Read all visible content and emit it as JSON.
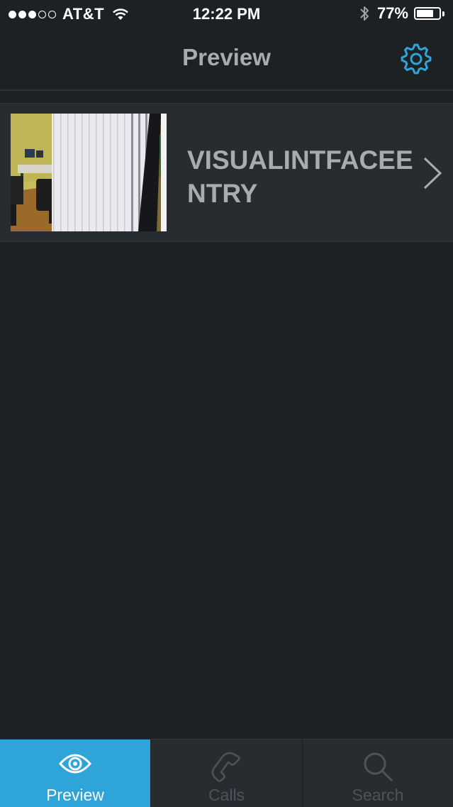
{
  "status_bar": {
    "signal_filled": 3,
    "signal_total": 5,
    "carrier": "AT&T",
    "time": "12:22 PM",
    "battery_percent_text": "77%",
    "battery_level": 0.77
  },
  "nav": {
    "title": "Preview",
    "settings_icon": "gear-icon",
    "accent_color": "#2ea4d9"
  },
  "cameras": [
    {
      "name": "VISUALINTFACEENTRY",
      "thumbnail": "office-room-camera-view"
    }
  ],
  "tabs": [
    {
      "label": "Preview",
      "icon": "eye-icon",
      "active": true
    },
    {
      "label": "Calls",
      "icon": "phone-icon",
      "active": false
    },
    {
      "label": "Search",
      "icon": "search-icon",
      "active": false
    }
  ]
}
